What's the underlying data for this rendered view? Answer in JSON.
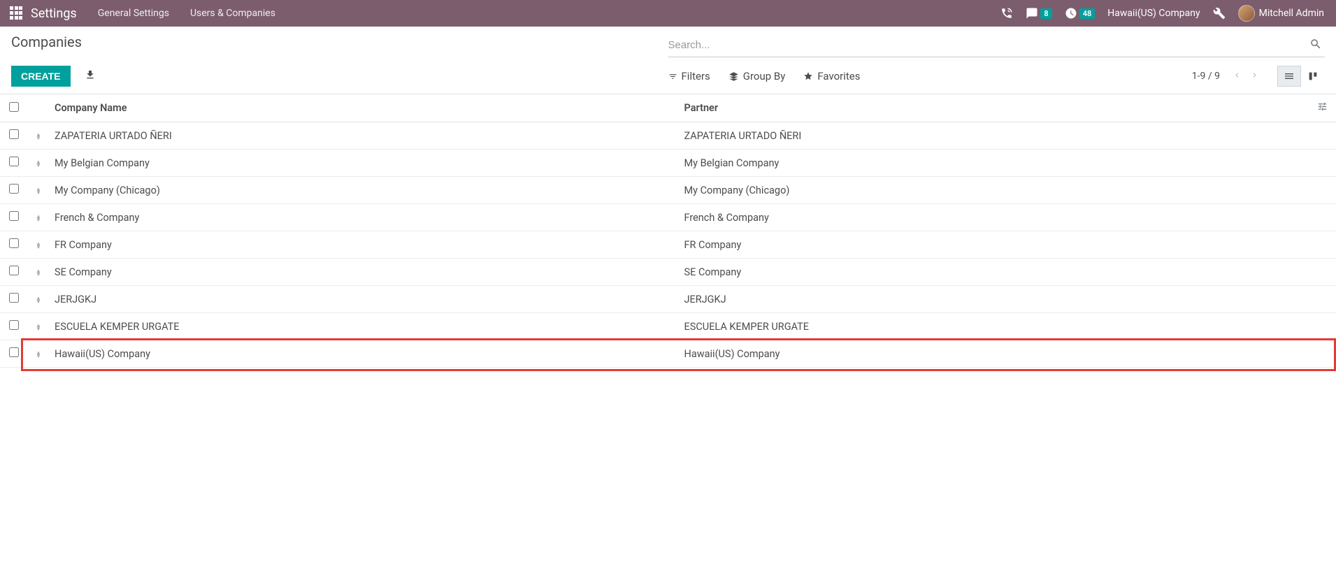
{
  "navbar": {
    "brand": "Settings",
    "menu": [
      "General Settings",
      "Users & Companies"
    ],
    "messages_badge": "8",
    "activities_badge": "48",
    "company": "Hawaii(US) Company",
    "user": "Mitchell Admin"
  },
  "control_panel": {
    "title": "Companies",
    "create_label": "CREATE",
    "search_placeholder": "Search...",
    "filters_label": "Filters",
    "groupby_label": "Group By",
    "favorites_label": "Favorites",
    "pager": "1-9 / 9"
  },
  "table": {
    "columns": {
      "name": "Company Name",
      "partner": "Partner"
    },
    "rows": [
      {
        "name": "ZAPATERIA URTADO ÑERI",
        "partner": "ZAPATERIA URTADO ÑERI",
        "highlighted": false
      },
      {
        "name": "My Belgian Company",
        "partner": "My Belgian Company",
        "highlighted": false
      },
      {
        "name": "My Company (Chicago)",
        "partner": "My Company (Chicago)",
        "highlighted": false
      },
      {
        "name": "French & Company",
        "partner": "French & Company",
        "highlighted": false
      },
      {
        "name": "FR Company",
        "partner": "FR Company",
        "highlighted": false
      },
      {
        "name": "SE Company",
        "partner": "SE Company",
        "highlighted": false
      },
      {
        "name": "JERJGKJ",
        "partner": "JERJGKJ",
        "highlighted": false
      },
      {
        "name": "ESCUELA KEMPER URGATE",
        "partner": "ESCUELA KEMPER URGATE",
        "highlighted": false
      },
      {
        "name": "Hawaii(US) Company",
        "partner": "Hawaii(US) Company",
        "highlighted": true
      }
    ]
  }
}
